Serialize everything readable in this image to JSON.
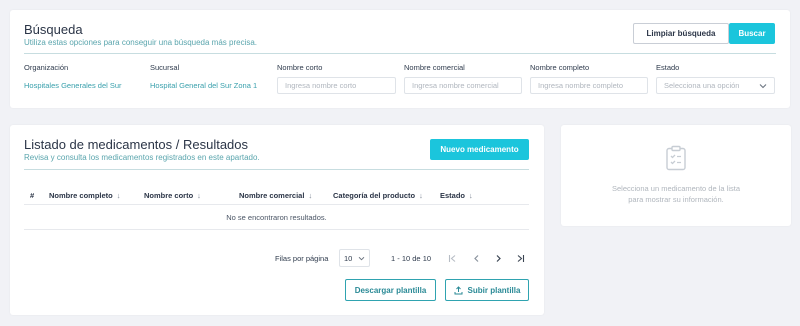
{
  "search": {
    "title": "Búsqueda",
    "subtitle": "Utiliza estas opciones para conseguir una búsqueda más precisa.",
    "clear_label": "Limpiar búsqueda",
    "search_label": "Buscar",
    "fields": {
      "organizacion": {
        "label": "Organización",
        "value": "Hospitales Generales del Sur"
      },
      "sucursal": {
        "label": "Sucursal",
        "value": "Hospital General del Sur Zona 1"
      },
      "nombre_corto": {
        "label": "Nombre corto",
        "placeholder": "Ingresa nombre corto"
      },
      "nombre_comercial": {
        "label": "Nombre comercial",
        "placeholder": "Ingresa nombre comercial"
      },
      "nombre_completo": {
        "label": "Nombre completo",
        "placeholder": "Ingresa nombre completo"
      },
      "estado": {
        "label": "Estado",
        "placeholder": "Selecciona una opción"
      }
    }
  },
  "list": {
    "title": "Listado de medicamentos / Resultados",
    "subtitle": "Revisa y consulta los medicamentos registrados en este apartado.",
    "new_label": "Nuevo medicamento",
    "columns": [
      "#",
      "Nombre completo",
      "Nombre corto",
      "Nombre comercial",
      "Categoría del producto",
      "Estado"
    ],
    "sort_arrow": "↓",
    "empty_message": "No se encontraron resultados.",
    "pagination": {
      "rows_per_page_label": "Filas por página",
      "rows_per_page_value": "10",
      "range_text": "1 - 10 de 10"
    },
    "download_label": "Descargar plantilla",
    "upload_label": "Subir plantilla"
  },
  "detail": {
    "empty_line1": "Selecciona un medicamento de la lista",
    "empty_line2": "para mostrar su información."
  },
  "colors": {
    "accent": "#1bc5dc",
    "teal_text": "#39a0ac",
    "background": "#f1f2f6"
  }
}
